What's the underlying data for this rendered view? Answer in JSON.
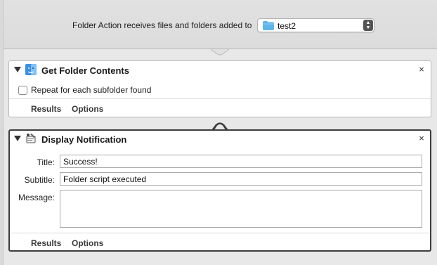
{
  "header": {
    "label": "Folder Action receives files and folders added to",
    "folder_value": "test2",
    "folder_icon": "folder-icon",
    "arrows_icon": "popup-arrows-icon"
  },
  "actions": [
    {
      "title": "Get Folder Contents",
      "icon": "finder-icon",
      "checkbox_label": "Repeat for each subfolder found",
      "checkbox_checked": false,
      "tabs": [
        "Results",
        "Options"
      ]
    },
    {
      "title": "Display Notification",
      "icon": "notification-script-icon",
      "fields": {
        "title_label": "Title:",
        "title_value": "Success!",
        "subtitle_label": "Subtitle:",
        "subtitle_value": "Folder script executed",
        "message_label": "Message:",
        "message_value": ""
      },
      "tabs": [
        "Results",
        "Options"
      ]
    }
  ],
  "close_glyph": "×",
  "colors": {
    "folder_blue": "#5fb4ea",
    "selected_border": "#3d3d3d"
  }
}
